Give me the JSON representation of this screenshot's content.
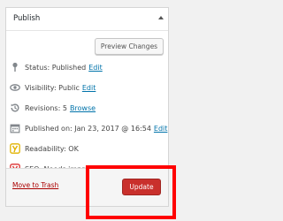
{
  "panel": {
    "title": "Publish"
  },
  "actions": {
    "preview_label": "Preview Changes"
  },
  "rows": {
    "status": {
      "label": "Status: Published",
      "link": "Edit"
    },
    "visibility": {
      "label": "Visibility: Public",
      "link": "Edit"
    },
    "revisions": {
      "label": "Revisions: 5",
      "link": "Browse"
    },
    "published": {
      "label": "Published on: Jan 23, 2017 @ 16:54",
      "link": "Edit"
    },
    "readability": {
      "label": "Readability: OK"
    },
    "seo": {
      "label": "SEO: Needs improvement"
    }
  },
  "footer": {
    "trash_label": "Move to Trash",
    "update_label": "Update"
  },
  "colors": {
    "link": "#0073aa",
    "update_button": "#c9302c",
    "highlight": "#ff0000",
    "yoast_ok": "#e0b200",
    "yoast_bad": "#dc3232"
  }
}
